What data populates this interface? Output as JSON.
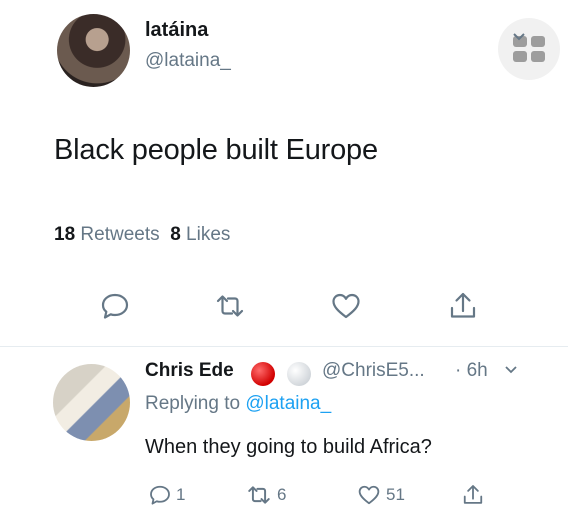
{
  "tweet": {
    "name": "latáina",
    "handle": "@lataina_",
    "text": "Black people built Europe",
    "retweets_count": "18",
    "retweets_label": "Retweets",
    "likes_count": "8",
    "likes_label": "Likes"
  },
  "reply": {
    "name": "Chris Ede",
    "handle": "@ChrisE5...",
    "time": "· 6h",
    "replying_prefix": "Replying to",
    "replying_to": "@lataina_",
    "text": "When they going to build Africa?",
    "replies": "1",
    "retweets": "6",
    "likes": "51"
  },
  "colors": {
    "text": "#14171a",
    "muted": "#657786",
    "link": "#1da1f2",
    "divider": "#e6ecf0"
  }
}
